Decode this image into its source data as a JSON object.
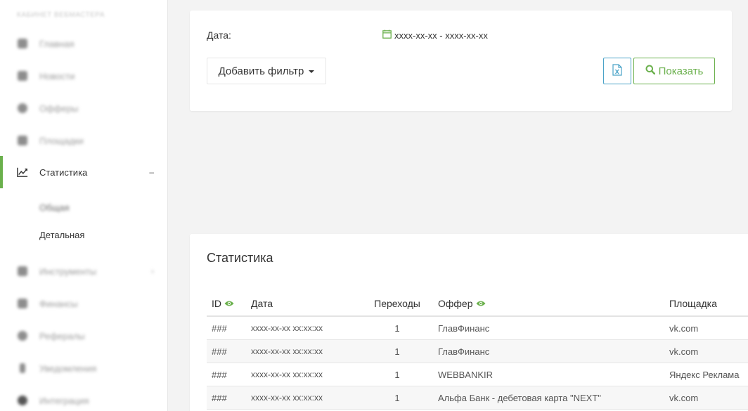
{
  "sidebar": {
    "heading": "Кабинет вебмастера",
    "items": [
      {
        "label": "Главная",
        "icon": "home-icon"
      },
      {
        "label": "Новости",
        "icon": "news-icon"
      },
      {
        "label": "Офферы",
        "icon": "offers-icon"
      },
      {
        "label": "Площадки",
        "icon": "sites-icon"
      },
      {
        "label": "Статистика",
        "icon": "chart-line-icon",
        "active": true,
        "toggle": "–"
      },
      {
        "label": "Инструменты",
        "icon": "tools-icon"
      },
      {
        "label": "Финансы",
        "icon": "finance-icon"
      },
      {
        "label": "Рефералы",
        "icon": "referrals-icon"
      },
      {
        "label": "Уведомления",
        "icon": "notifications-icon"
      },
      {
        "label": "Интеграция",
        "icon": "integration-icon"
      }
    ],
    "subitems": [
      {
        "label": "Общая"
      },
      {
        "label": "Детальная"
      }
    ]
  },
  "filters": {
    "date_label": "Дата:",
    "date_range": "xxxx-xx-xx - xxxx-xx-xx",
    "add_filter_label": "Добавить фильтр",
    "show_label": "Показать"
  },
  "stats": {
    "title": "Статистика",
    "columns": {
      "id": "ID",
      "date": "Дата",
      "clicks": "Переходы",
      "offer": "Оффер",
      "site": "Площадка"
    },
    "rows": [
      {
        "id": "###",
        "date": "xxxx-xx-xx xx:xx:xx",
        "clicks": "1",
        "offer": "ГлавФинанс",
        "site": "vk.com"
      },
      {
        "id": "###",
        "date": "xxxx-xx-xx xx:xx:xx",
        "clicks": "1",
        "offer": "ГлавФинанс",
        "site": "vk.com"
      },
      {
        "id": "###",
        "date": "xxxx-xx-xx xx:xx:xx",
        "clicks": "1",
        "offer": "WEBBANKIR",
        "site": "Яндекс Реклама"
      },
      {
        "id": "###",
        "date": "xxxx-xx-xx xx:xx:xx",
        "clicks": "1",
        "offer": "Альфа Банк - дебетовая карта \"NEXT\"",
        "site": "vk.com"
      }
    ]
  },
  "colors": {
    "accent_green": "#6ab04c",
    "excel_blue": "#4aa3c8",
    "background": "#f3f3f3"
  }
}
